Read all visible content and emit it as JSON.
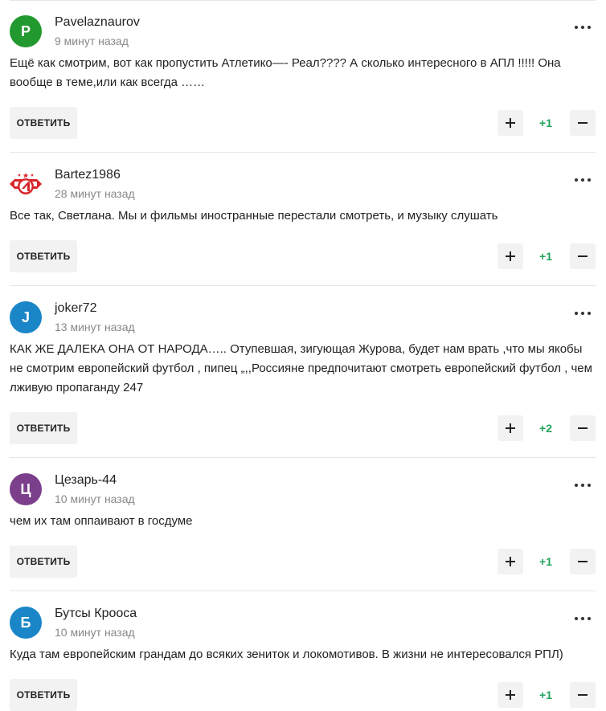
{
  "comments": [
    {
      "author": "Pavelaznaurov",
      "avatar_letter": "P",
      "avatar_color": "#22992e",
      "time": "9 минут назад",
      "text": "Ещё как смотрим, вот как пропустить Атлетико—- Реал???? А сколько интересного в АПЛ !!!!! Она вообще в теме,или как всегда ……",
      "reply_label": "ОТВЕТИТЬ",
      "score": "+1"
    },
    {
      "author": "Bartez1986",
      "avatar_icon": "spartak-logo-icon",
      "avatar_color": "#d8252c",
      "time": "28 минут назад",
      "text": "Все так, Светлана. Мы и фильмы иностранные перестали смотреть, и музыку слушать",
      "reply_label": "ОТВЕТИТЬ",
      "score": "+1"
    },
    {
      "author": "joker72",
      "avatar_letter": "J",
      "avatar_color": "#1a86c8",
      "time": "13 минут назад",
      "text": "КАК ЖЕ ДАЛЕКА ОНА ОТ НАРОДА….. Отупевшая, зигующая Журова, будет нам врать ,что мы якобы не смотрим европейский футбол , пипец „,,Россияне предпочитают смотреть европейский футбол , чем лживую пропаганду 247",
      "reply_label": "ОТВЕТИТЬ",
      "score": "+2"
    },
    {
      "author": "Цезарь-44",
      "avatar_letter": "Ц",
      "avatar_color": "#7b3f8c",
      "time": "10 минут назад",
      "text": "чем их там оппаивают в госдуме",
      "reply_label": "ОТВЕТИТЬ",
      "score": "+1"
    },
    {
      "author": "Бутсы Крооса",
      "avatar_letter": "Б",
      "avatar_color": "#1a86c8",
      "time": "10 минут назад",
      "text": "Куда там европейским грандам до всяких зениток и локомотивов. В жизни не интересовался РПЛ)",
      "reply_label": "ОТВЕТИТЬ",
      "score": "+1"
    }
  ],
  "icons": {
    "more": "more-dots-icon",
    "plus": "plus-icon",
    "minus": "minus-icon"
  },
  "colors": {
    "score": "#1fa35b",
    "button_bg": "#f2f2f2",
    "divider": "#e6e6e6",
    "muted": "#888888"
  }
}
